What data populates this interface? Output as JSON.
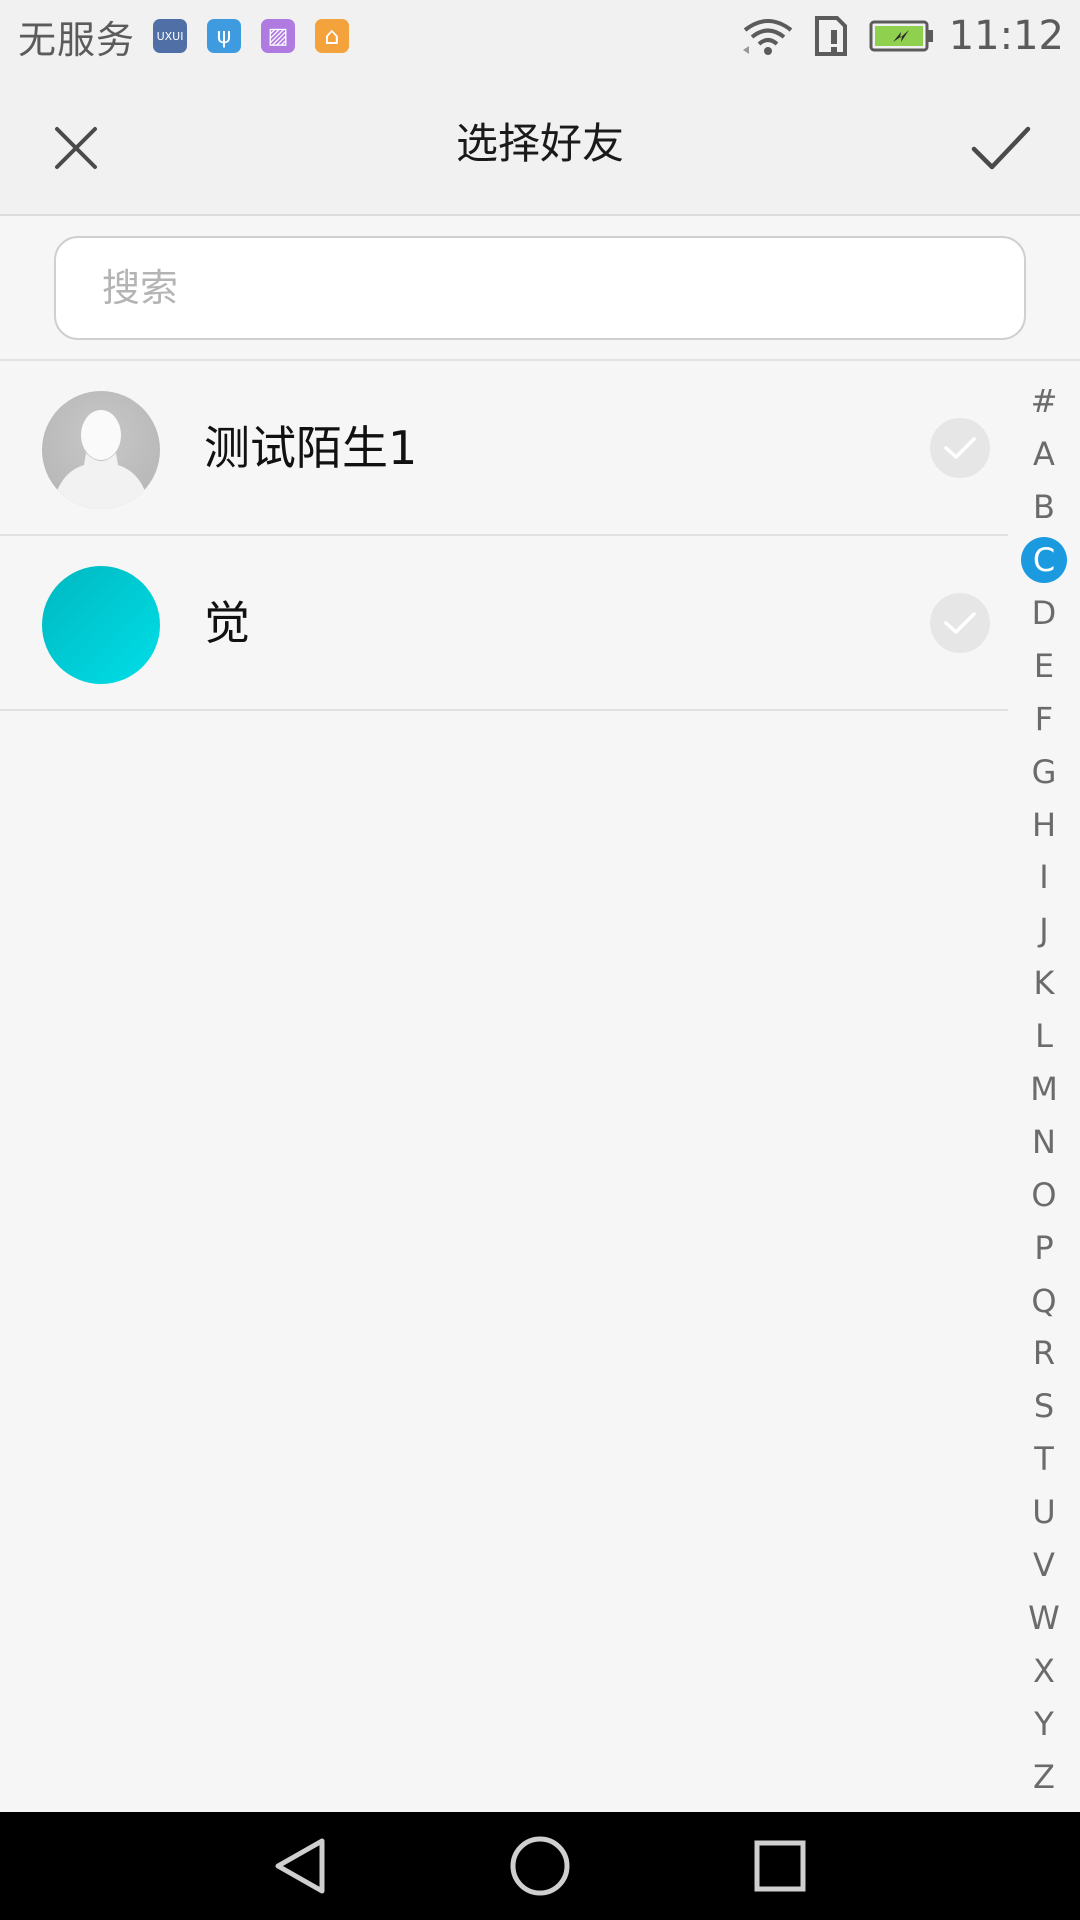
{
  "status_bar": {
    "carrier": "无服务",
    "notification_icons": [
      {
        "name": "uxui-app-icon",
        "color": "#4f6fa6",
        "glyph": "UXUI"
      },
      {
        "name": "usb-icon",
        "color": "#3e9be0",
        "glyph": "ψ"
      },
      {
        "name": "gallery-icon",
        "color": "#b07be0",
        "glyph": "▨"
      },
      {
        "name": "home-app-icon",
        "color": "#f3a23c",
        "glyph": "⌂"
      }
    ],
    "time": "11:12",
    "battery_color": "#8fd14f"
  },
  "header": {
    "title": "选择好友",
    "close_icon": "close-icon",
    "confirm_icon": "checkmark-icon"
  },
  "search": {
    "placeholder": "搜索",
    "value": ""
  },
  "contacts": [
    {
      "name": "测试陌生1",
      "avatar": "default-person",
      "selected": false
    },
    {
      "name": "觉",
      "avatar": "teal-gradient",
      "selected": false
    }
  ],
  "alpha_index": {
    "letters": [
      "#",
      "A",
      "B",
      "C",
      "D",
      "E",
      "F",
      "G",
      "H",
      "I",
      "J",
      "K",
      "L",
      "M",
      "N",
      "O",
      "P",
      "Q",
      "R",
      "S",
      "T",
      "U",
      "V",
      "W",
      "X",
      "Y",
      "Z"
    ],
    "active": "C",
    "active_color": "#1b9ae0"
  },
  "nav_bar": {
    "buttons": [
      "back-icon",
      "home-icon",
      "recents-icon"
    ]
  }
}
